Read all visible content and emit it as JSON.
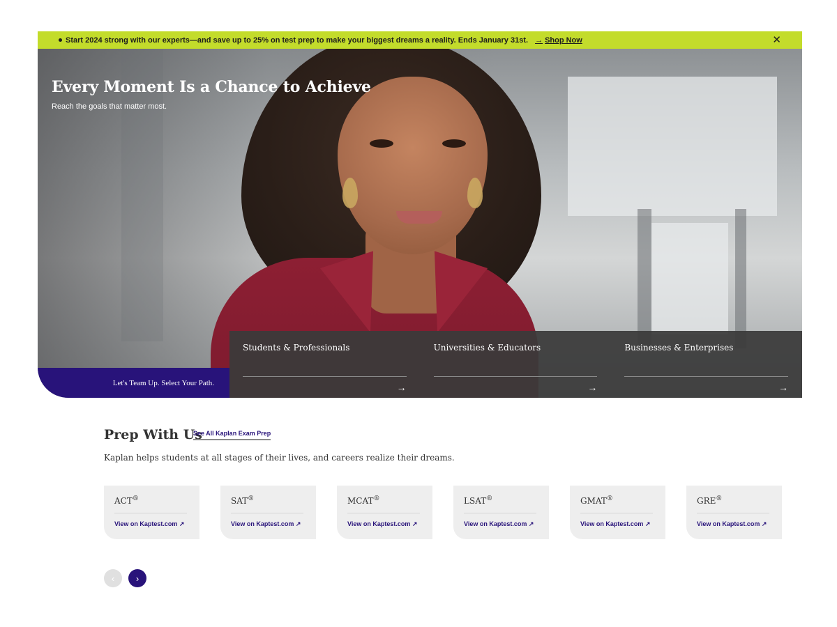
{
  "promo": {
    "message": "Start 2024 strong with our experts—and save up to 25% on test prep to make your biggest dreams a reality. Ends January 31st.",
    "shop_arrow": "→",
    "shop_label": "Shop Now",
    "close_glyph": "✕",
    "bg_color": "#c3dc2b"
  },
  "hero": {
    "title": "Every Moment Is a Chance to Achieve",
    "subtitle": "Reach the goals that matter most.",
    "team_label": "Let's Team Up. Select Your Path.",
    "paths": [
      {
        "label": "Students & Professionals",
        "icon": "arrow-right-icon"
      },
      {
        "label": "Universities & Educators",
        "icon": "arrow-right-icon"
      },
      {
        "label": "Businesses & Enterprises",
        "icon": "arrow-right-icon"
      }
    ],
    "arrow_glyph": "→",
    "accent_color": "#28137a"
  },
  "prep": {
    "title": "Prep With Us",
    "see_all": "See All Kaplan Exam Prep",
    "description": "Kaplan helps students at all stages of their lives, and careers realize their dreams.",
    "reg": "®",
    "link_label": "View on Kaptest.com ↗",
    "cards": [
      {
        "name": "ACT"
      },
      {
        "name": "SAT"
      },
      {
        "name": "MCAT"
      },
      {
        "name": "LSAT"
      },
      {
        "name": "GMAT"
      },
      {
        "name": "GRE"
      }
    ],
    "prev_glyph": "‹",
    "next_glyph": "›"
  }
}
